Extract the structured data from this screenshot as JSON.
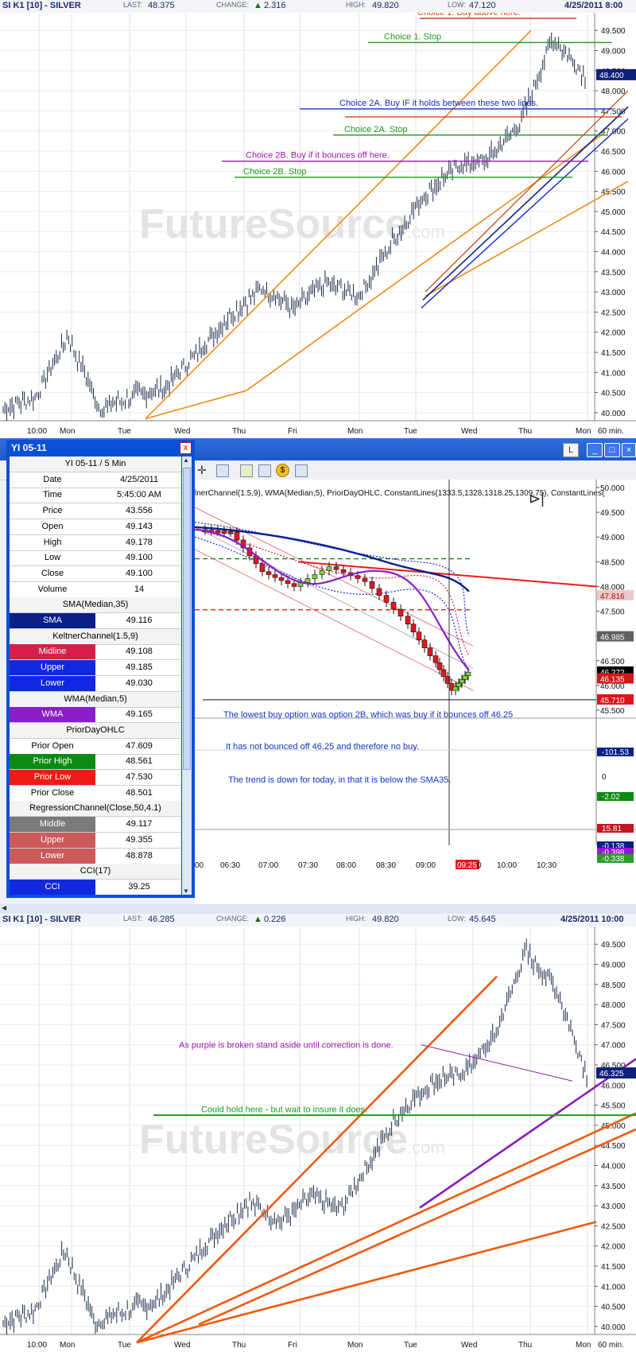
{
  "top_chart": {
    "symbol": "SI K1 [10] - SILVER",
    "last_label": "LAST:",
    "last": "48.375",
    "change_label": "CHANGE:",
    "change": "2.316",
    "high_label": "HIGH:",
    "high": "49.820",
    "low_label": "LOW:",
    "low": "47.120",
    "datetime": "4/25/2011 8:00",
    "price_tag": "48.400",
    "interval": "60 min.",
    "watermark": "FutureSource",
    "watermark_suffix": ".com"
  },
  "middle": {
    "lbutton": "L",
    "indicator_header": "lnerChannel(1.5,9), WMA(Median,5), PriorDayOHLC, ConstantLines(1333.5,1328,1318.25,1309.75), ConstantLines(",
    "data_window": {
      "title": "YI 05-11",
      "close_btn": "x",
      "rows": [
        {
          "type": "section",
          "text": "YI 05-11 / 5 Min"
        },
        {
          "type": "row",
          "label": "Date",
          "value": "4/25/2011"
        },
        {
          "type": "row",
          "label": "Time",
          "value": "5:45:00 AM"
        },
        {
          "type": "row",
          "label": "Price",
          "value": "43.556"
        },
        {
          "type": "row",
          "label": "Open",
          "value": "49.143"
        },
        {
          "type": "row",
          "label": "High",
          "value": "49.178"
        },
        {
          "type": "row",
          "label": "Low",
          "value": "49.100"
        },
        {
          "type": "row",
          "label": "Close",
          "value": "49.100"
        },
        {
          "type": "row",
          "label": "Volume",
          "value": "14"
        },
        {
          "type": "section",
          "text": "SMA(Median,35)"
        },
        {
          "type": "row",
          "label": "SMA",
          "value": "49.116",
          "color": "#0a1f8a"
        },
        {
          "type": "section",
          "text": "KeltnerChannel(1.5,9)"
        },
        {
          "type": "row",
          "label": "Midline",
          "value": "49.108",
          "color": "#d81e4a"
        },
        {
          "type": "row",
          "label": "Upper",
          "value": "49.185",
          "color": "#1028e0"
        },
        {
          "type": "row",
          "label": "Lower",
          "value": "49.030",
          "color": "#1028e0"
        },
        {
          "type": "section",
          "text": "WMA(Median,5)"
        },
        {
          "type": "row",
          "label": "WMA",
          "value": "49.165",
          "color": "#8a1ec8"
        },
        {
          "type": "section",
          "text": "PriorDayOHLC"
        },
        {
          "type": "row",
          "label": "Prior Open",
          "value": "47.609"
        },
        {
          "type": "row",
          "label": "Prior High",
          "value": "48.561",
          "color": "#0e8a12"
        },
        {
          "type": "row",
          "label": "Prior Low",
          "value": "47.530",
          "color": "#ee1a14"
        },
        {
          "type": "row",
          "label": "Prior Close",
          "value": "48.501"
        },
        {
          "type": "section",
          "text": "RegressionChannel(Close,50,4.1)"
        },
        {
          "type": "row",
          "label": "Middle",
          "value": "49.117",
          "color": "#7a7a7a"
        },
        {
          "type": "row",
          "label": "Upper",
          "value": "49.355",
          "color": "#cc5a5a"
        },
        {
          "type": "row",
          "label": "Lower",
          "value": "48.878",
          "color": "#cc5a5a"
        },
        {
          "type": "section",
          "text": "CCI(17)"
        },
        {
          "type": "row",
          "label": "CCI",
          "value": "39.25",
          "color": "#1028e0"
        }
      ]
    },
    "notes": [
      "The lowest buy option was option 2B, which was buy if it bounces off 46.25",
      "It has not bounced off 46.25 and therefore no buy.",
      "The trend is down for today, in that it is below the SMA35."
    ],
    "time_labels": [
      "00",
      "06:30",
      "07:00",
      "07:30",
      "08:00",
      "08:30",
      "09:00",
      "09:25",
      "0",
      "10:00",
      "10:30"
    ],
    "price_ticks": [
      "50.000",
      "49.500",
      "49.000",
      "48.500",
      "48.000",
      "47.500",
      "47.000",
      "46.500",
      "46.000",
      "45.500"
    ],
    "price_tags": [
      {
        "text": "47.816",
        "color": "#f0c8c8",
        "fg": "#a01010"
      },
      {
        "text": "46.985",
        "color": "#606060",
        "fg": "#ffffff"
      },
      {
        "text": "46.272",
        "color": "#000000",
        "fg": "#ffffff"
      },
      {
        "text": "46.135",
        "color": "#d01818",
        "fg": "#ffffff"
      },
      {
        "text": "45.710",
        "color": "#e0141c",
        "fg": "#ffffff"
      }
    ],
    "cci_tags": [
      {
        "text": "-101.53",
        "color": "#0a1f8a"
      },
      {
        "text": "0",
        "color": "#ffffff"
      },
      {
        "text": "-2.02",
        "color": "#0e8a12"
      },
      {
        "text": "15.81",
        "color": "#c01820"
      },
      {
        "text": "-0.138",
        "color": "#0a1f8a"
      },
      {
        "text": "-0.398",
        "color": "#8a1ec8"
      },
      {
        "text": "-0.338",
        "color": "#2a9a2a"
      }
    ]
  },
  "bottom_chart": {
    "symbol": "SI K1 [10] - SILVER",
    "last_label": "LAST:",
    "last": "46.285",
    "change_label": "CHANGE:",
    "change": "0.226",
    "high_label": "HIGH:",
    "high": "49.820",
    "low_label": "LOW:",
    "low": "45.645",
    "datetime": "4/25/2011 10:00",
    "price_tag": "46.325",
    "interval": "60 min.",
    "watermark": "FutureSource",
    "watermark_suffix": ".com"
  },
  "annotations_top": [
    {
      "text": "Choice 1. Buy above here.",
      "color": "#d04010"
    },
    {
      "text": "Choice 1. Stop",
      "color": "#1a9a1a"
    },
    {
      "text": "Choice 2A. Buy IF it holds between these two lines.",
      "color": "#1a2ac8"
    },
    {
      "text": "Choice 2A. Stop",
      "color": "#1a9a1a"
    },
    {
      "text": "Choice 2B. Buy if it bounces off here.",
      "color": "#9a1ab0"
    },
    {
      "text": "Choice 2B. Stop",
      "color": "#1a9a1a"
    }
  ],
  "annotations_bottom": [
    {
      "text": "As purple is broken stand aside until correction is done.",
      "color": "#9a1ab0"
    },
    {
      "text": "Could hold here - but wait to insure it does.",
      "color": "#1a9a1a"
    }
  ],
  "chart_data": [
    {
      "type": "line",
      "title": "SI K1 [10] - SILVER",
      "interval": "60 min.",
      "x": [
        "10:00",
        "Mon",
        "Tue",
        "Wed",
        "Thu",
        "Fri",
        "Mon",
        "Tue",
        "Wed",
        "Thu",
        "Mon"
      ],
      "y_ticks": [
        40.0,
        40.5,
        41.0,
        41.5,
        42.0,
        42.5,
        43.0,
        43.5,
        44.0,
        44.5,
        45.0,
        45.5,
        46.0,
        46.5,
        47.0,
        47.5,
        48.0,
        48.5,
        49.0,
        49.5
      ],
      "ylim": [
        39.8,
        49.9
      ],
      "series": [
        {
          "values": [
            40.1,
            40.4,
            41.9,
            40.1,
            40.4,
            40.6,
            41.5,
            42.4,
            43.1,
            42.6,
            43.2,
            42.9,
            44.2,
            45.4,
            46.1,
            46.3,
            47.2,
            49.3,
            48.4
          ]
        }
      ],
      "horizontal_levels": {
        "Choice 1. Buy above here.": 49.8,
        "Choice 1. Stop": 49.2,
        "Choice 2A. Buy IF it holds between these two lines.": 47.55,
        "Choice 2A. Stop": 46.9,
        "Choice 2B. Buy if it bounces off here.": 46.25,
        "Choice 2B. Stop": 45.85
      }
    },
    {
      "type": "line",
      "title": "YI 05-11 / 5 Min",
      "x": [
        "06:30",
        "07:00",
        "07:30",
        "08:00",
        "08:30",
        "09:00",
        "09:25",
        "10:00",
        "10:30"
      ],
      "ylim": [
        45.5,
        50.0
      ],
      "series": [
        {
          "values": [
            49.15,
            49.1,
            48.3,
            48.0,
            48.4,
            48.1,
            47.4,
            46.6,
            45.9,
            46.27
          ]
        }
      ],
      "reference_levels": {
        "prior_high": 48.561,
        "prior_low": 47.53,
        "red_line": 48.0
      }
    },
    {
      "type": "line",
      "title": "SI K1 [10] - SILVER",
      "interval": "60 min.",
      "x": [
        "10:00",
        "Mon",
        "Tue",
        "Wed",
        "Thu",
        "Fri",
        "Mon",
        "Tue",
        "Wed",
        "Thu",
        "Mon"
      ],
      "y_ticks": [
        40.0,
        40.5,
        41.0,
        41.5,
        42.0,
        42.5,
        43.0,
        43.5,
        44.0,
        44.5,
        45.0,
        45.5,
        46.0,
        46.5,
        47.0,
        47.5,
        48.0,
        48.5,
        49.0,
        49.5
      ],
      "ylim": [
        39.8,
        49.9
      ],
      "series": [
        {
          "values": [
            40.1,
            40.4,
            41.9,
            40.1,
            40.4,
            40.6,
            41.5,
            42.4,
            43.1,
            42.6,
            43.2,
            42.9,
            44.2,
            45.4,
            46.1,
            46.3,
            47.2,
            49.3,
            48.4,
            46.3
          ]
        }
      ],
      "horizontal_levels": {
        "Could hold here - but wait to insure it does.": 45.25
      }
    }
  ]
}
